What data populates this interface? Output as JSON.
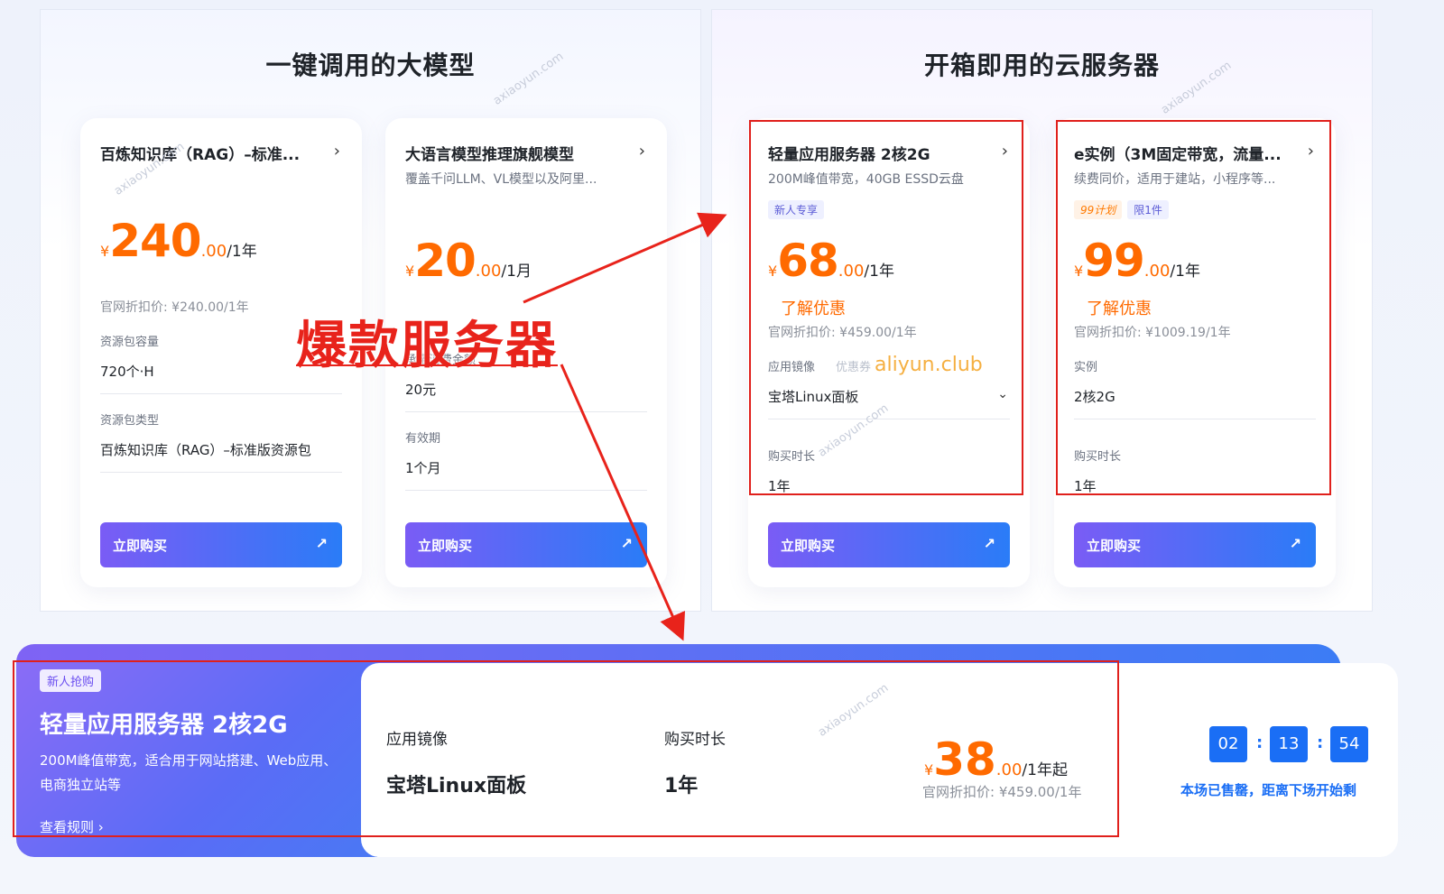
{
  "left_panel": {
    "title": "一键调用的大模型",
    "cards": [
      {
        "title": "百炼知识库（RAG）–标准...",
        "price_yen": "¥",
        "price_int": "240",
        "price_dec": ".00",
        "price_unit": "/1年",
        "orig": "官网折扣价: ¥240.00/1年",
        "fields": [
          {
            "label": "资源包容量",
            "value": "720个·H"
          },
          {
            "label": "资源包类型",
            "value": "百炼知识库（RAG）–标准版资源包"
          }
        ],
        "buy": "立即购买"
      },
      {
        "title": "大语言模型推理旗舰模型",
        "subtitle": "覆盖千问LLM、VL模型以及阿里...",
        "price_yen": "¥",
        "price_int": "20",
        "price_dec": ".00",
        "price_unit": "/1月",
        "fields": [
          {
            "label": "承诺消费金额",
            "value": "20元"
          },
          {
            "label": "有效期",
            "value": "1个月"
          }
        ],
        "buy": "立即购买"
      }
    ]
  },
  "right_panel": {
    "title": "开箱即用的云服务器",
    "cards": [
      {
        "title": "轻量应用服务器 2核2G",
        "subtitle": "200M峰值带宽，40GB ESSD云盘",
        "tags": [
          "新人专享"
        ],
        "price_yen": "¥",
        "price_int": "68",
        "price_dec": ".00",
        "price_unit": "/1年",
        "promo": "了解优惠",
        "orig": "官网折扣价: ¥459.00/1年",
        "fields": [
          {
            "label": "应用镜像",
            "value": "宝塔Linux面板"
          },
          {
            "label": "购买时长",
            "value": "1年"
          }
        ],
        "buy": "立即购买"
      },
      {
        "title": "e实例（3M固定带宽，流量...",
        "subtitle": "续费同价，适用于建站，小程序等...",
        "tags": [
          "99计划",
          "限1件"
        ],
        "price_yen": "¥",
        "price_int": "99",
        "price_dec": ".00",
        "price_unit": "/1年",
        "promo": "了解优惠",
        "orig": "官网折扣价: ¥1009.19/1年",
        "fields": [
          {
            "label": "实例",
            "value": "2核2G"
          },
          {
            "label": "购买时长",
            "value": "1年"
          }
        ],
        "buy": "立即购买"
      }
    ]
  },
  "overlay": {
    "headline": "爆款服务器",
    "coupon_label": "优惠券",
    "coupon_site": "aliyun.club"
  },
  "banner": {
    "tag": "新人抢购",
    "title": "轻量应用服务器 2核2G",
    "desc": "200M峰值带宽，适合用于网站搭建、Web应用、电商独立站等",
    "rule": "查看规则 ›",
    "image_label": "应用镜像",
    "image_value": "宝塔Linux面板",
    "duration_label": "购买时长",
    "duration_value": "1年",
    "price_yen": "¥",
    "price_int": "38",
    "price_dec": ".00",
    "price_unit": "/1年起",
    "orig": "官网折扣价: ¥459.00/1年",
    "countdown": [
      "02",
      "13",
      "54"
    ],
    "countdown_text": "本场已售罄，距离下场开始剩"
  },
  "watermark": "axiaoyun.com",
  "colors": {
    "accent_orange": "#ff6a00",
    "accent_blue": "#1a6ef5",
    "annotation_red": "#e0201c"
  }
}
